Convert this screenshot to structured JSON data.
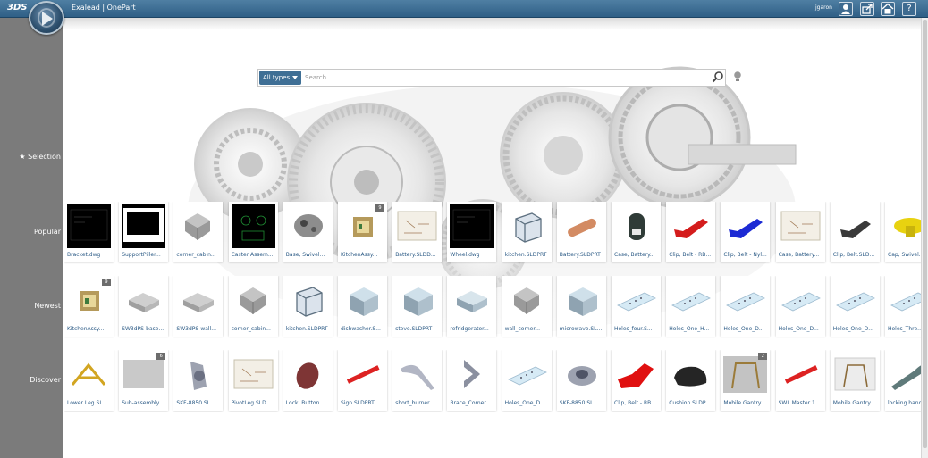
{
  "header": {
    "brand": "3DS",
    "app_title": "Exalead | OnePart",
    "user": "jgaron",
    "icons": [
      "user-icon",
      "share-icon",
      "home-icon",
      "help-icon"
    ],
    "help_label": "?"
  },
  "search": {
    "type_label": "All types",
    "placeholder": "Search..."
  },
  "sidebar": {
    "selection": "★ Selection",
    "popular": "Popular",
    "newest": "Newest",
    "discover": "Discover"
  },
  "colors": {
    "topbar": "#3a678c",
    "sidebar": "#7b7b7b",
    "link": "#2b5a85",
    "accent_red": "#d22222"
  },
  "rows": {
    "popular": [
      {
        "label": "Bracket.dwg",
        "thumb": "dark"
      },
      {
        "label": "SupportPiller...",
        "thumb": "dark2"
      },
      {
        "label": "corner_cabin...",
        "thumb": "gray-bracket"
      },
      {
        "label": "Caster Assem...",
        "thumb": "dark-green"
      },
      {
        "label": "Base, Swivel...",
        "thumb": "swivel"
      },
      {
        "label": "KitchenAssy...",
        "thumb": "kitchen",
        "badge": "9"
      },
      {
        "label": "Battery.SLDD...",
        "thumb": "drawing"
      },
      {
        "label": "Wheel.dwg",
        "thumb": "dark"
      },
      {
        "label": "kitchen.SLDPRT",
        "thumb": "box-frame"
      },
      {
        "label": "Battery.SLDPRT",
        "thumb": "copper"
      },
      {
        "label": "Case, Battery...",
        "thumb": "case"
      },
      {
        "label": "Clip, Belt - RB...",
        "thumb": "red-clip"
      },
      {
        "label": "Clip, Belt - Nyl...",
        "thumb": "blue-clip"
      },
      {
        "label": "Case, Battery...",
        "thumb": "drawing"
      },
      {
        "label": "Clip, Belt.SLD...",
        "thumb": "dark-clip"
      },
      {
        "label": "Cap, Swivel...",
        "thumb": "yellow-cap"
      }
    ],
    "newest": [
      {
        "label": "KitchenAssy...",
        "thumb": "kitchen",
        "badge": "9"
      },
      {
        "label": "SW3dPS-base...",
        "thumb": "gray-plate"
      },
      {
        "label": "SW3dPS-wall...",
        "thumb": "gray-plate"
      },
      {
        "label": "corner_cabin...",
        "thumb": "gray-bracket"
      },
      {
        "label": "kitchen.SLDPRT",
        "thumb": "box-frame"
      },
      {
        "label": "dishwasher.S...",
        "thumb": "cube"
      },
      {
        "label": "stove.SLDPRT",
        "thumb": "cube"
      },
      {
        "label": "refridgerator...",
        "thumb": "cube-flat"
      },
      {
        "label": "wall_corner...",
        "thumb": "gray-bracket"
      },
      {
        "label": "microwave.SL...",
        "thumb": "cube"
      },
      {
        "label": "Holes_four.S...",
        "thumb": "plate-holes"
      },
      {
        "label": "Holes_One_H...",
        "thumb": "plate-holes"
      },
      {
        "label": "Holes_One_D...",
        "thumb": "plate-holes"
      },
      {
        "label": "Holes_One_D...",
        "thumb": "plate-holes"
      },
      {
        "label": "Holes_One_D...",
        "thumb": "plate-holes"
      },
      {
        "label": "Holes_Thre...",
        "thumb": "plate-holes"
      }
    ],
    "discover": [
      {
        "label": "Lower Leg.SL...",
        "thumb": "yellow-leg"
      },
      {
        "label": "Sub-assembly...",
        "thumb": "gray-fill",
        "badge": "6"
      },
      {
        "label": "SKF-8850.SL...",
        "thumb": "bearing"
      },
      {
        "label": "PivotLeg.SLD...",
        "thumb": "drawing"
      },
      {
        "label": "Lock, Button...",
        "thumb": "lock"
      },
      {
        "label": "Sign.SLDPRT",
        "thumb": "red-bar"
      },
      {
        "label": "short_burner...",
        "thumb": "burner"
      },
      {
        "label": "Brace_Corner...",
        "thumb": "brace"
      },
      {
        "label": "Holes_One_D...",
        "thumb": "plate-holes"
      },
      {
        "label": "SKF-8850.SL...",
        "thumb": "bearing2"
      },
      {
        "label": "Clip, Belt - RB...",
        "thumb": "red-clip2"
      },
      {
        "label": "Cushion.SLDP...",
        "thumb": "cushion"
      },
      {
        "label": "Mobile Gantry...",
        "thumb": "gantry",
        "badge": "2"
      },
      {
        "label": "SWL Master 1...",
        "thumb": "red-bar"
      },
      {
        "label": "Mobile Gantry...",
        "thumb": "gantry-draw"
      },
      {
        "label": "locking hand...",
        "thumb": "handle"
      }
    ]
  }
}
